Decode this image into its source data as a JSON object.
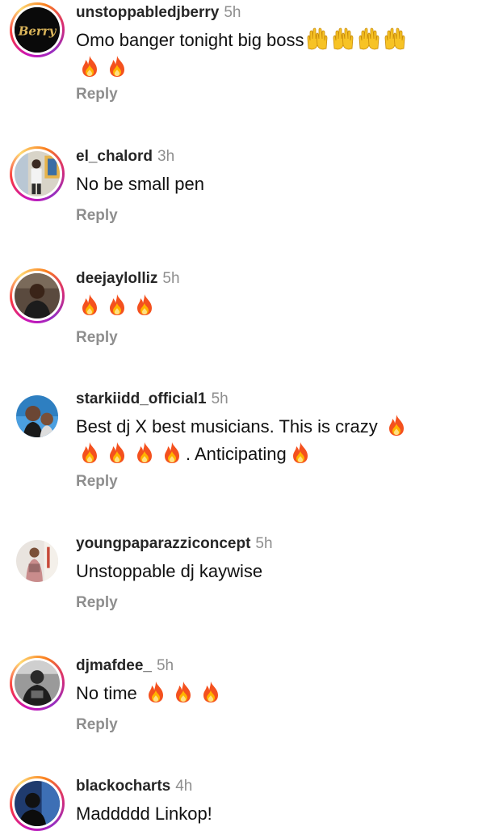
{
  "comments": [
    {
      "username": "unstoppabledjberry",
      "time": "5h",
      "avatar_label": "Berry",
      "text_before": "Omo banger tonight big boss",
      "reply": "Reply"
    },
    {
      "username": "el_chalord",
      "time": "3h",
      "text": "No be small pen",
      "reply": "Reply"
    },
    {
      "username": "deejaylolliz",
      "time": "5h",
      "reply": "Reply"
    },
    {
      "username": "starkiidd_official1",
      "time": "5h",
      "text_line1": "Best dj X best musicians. This is crazy",
      "text_line2": ". Anticipating",
      "reply": "Reply"
    },
    {
      "username": "youngpaparazziconcept",
      "time": "5h",
      "text": "Unstoppable dj kaywise",
      "reply": "Reply"
    },
    {
      "username": "djmafdee_",
      "time": "5h",
      "text": "No time",
      "reply": "Reply"
    },
    {
      "username": "blackocharts",
      "time": "4h",
      "text": "Maddddd Linkop!"
    }
  ],
  "icons": {
    "fire": "fire-emoji",
    "raised_hands": "raised-hands-emoji"
  },
  "colors": {
    "username": "#262626",
    "meta": "#8e8e8e",
    "story_ring": "#d62976"
  }
}
